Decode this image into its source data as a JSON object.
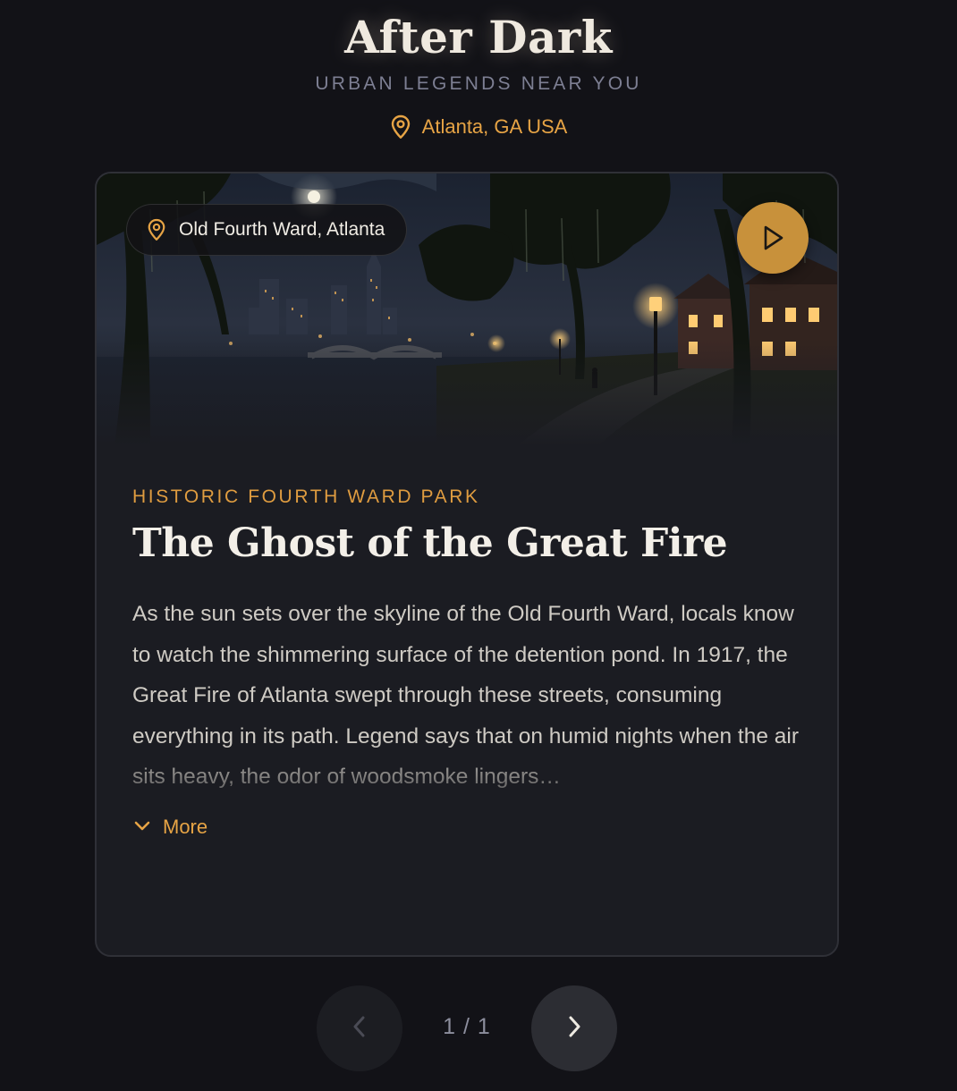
{
  "header": {
    "title": "After Dark",
    "subtitle": "URBAN LEGENDS NEAR YOU",
    "location": "Atlanta, GA USA"
  },
  "card": {
    "image_location": "Old Fourth Ward, Atlanta",
    "kicker": "HISTORIC FOURTH WARD PARK",
    "title": "The Ghost of the Great Fire",
    "body": "As the sun sets over the skyline of the Old Fourth Ward, locals know to watch the shimmering surface of the detention pond. In 1917, the Great Fire of Atlanta swept through these streets, consuming everything in its path. Legend says that on humid nights when the air sits heavy, the odor of woodsmoke lingers…",
    "more_label": "More"
  },
  "pager": {
    "count": "1 / 1"
  },
  "colors": {
    "background": "#121217",
    "card": "#1b1c22",
    "accent": "#e7a445",
    "play_button": "#c8913b"
  },
  "icons": {
    "location": "map-pin-icon",
    "play": "play-icon",
    "more": "chevron-down-icon",
    "prev": "chevron-left-icon",
    "next": "chevron-right-icon"
  }
}
